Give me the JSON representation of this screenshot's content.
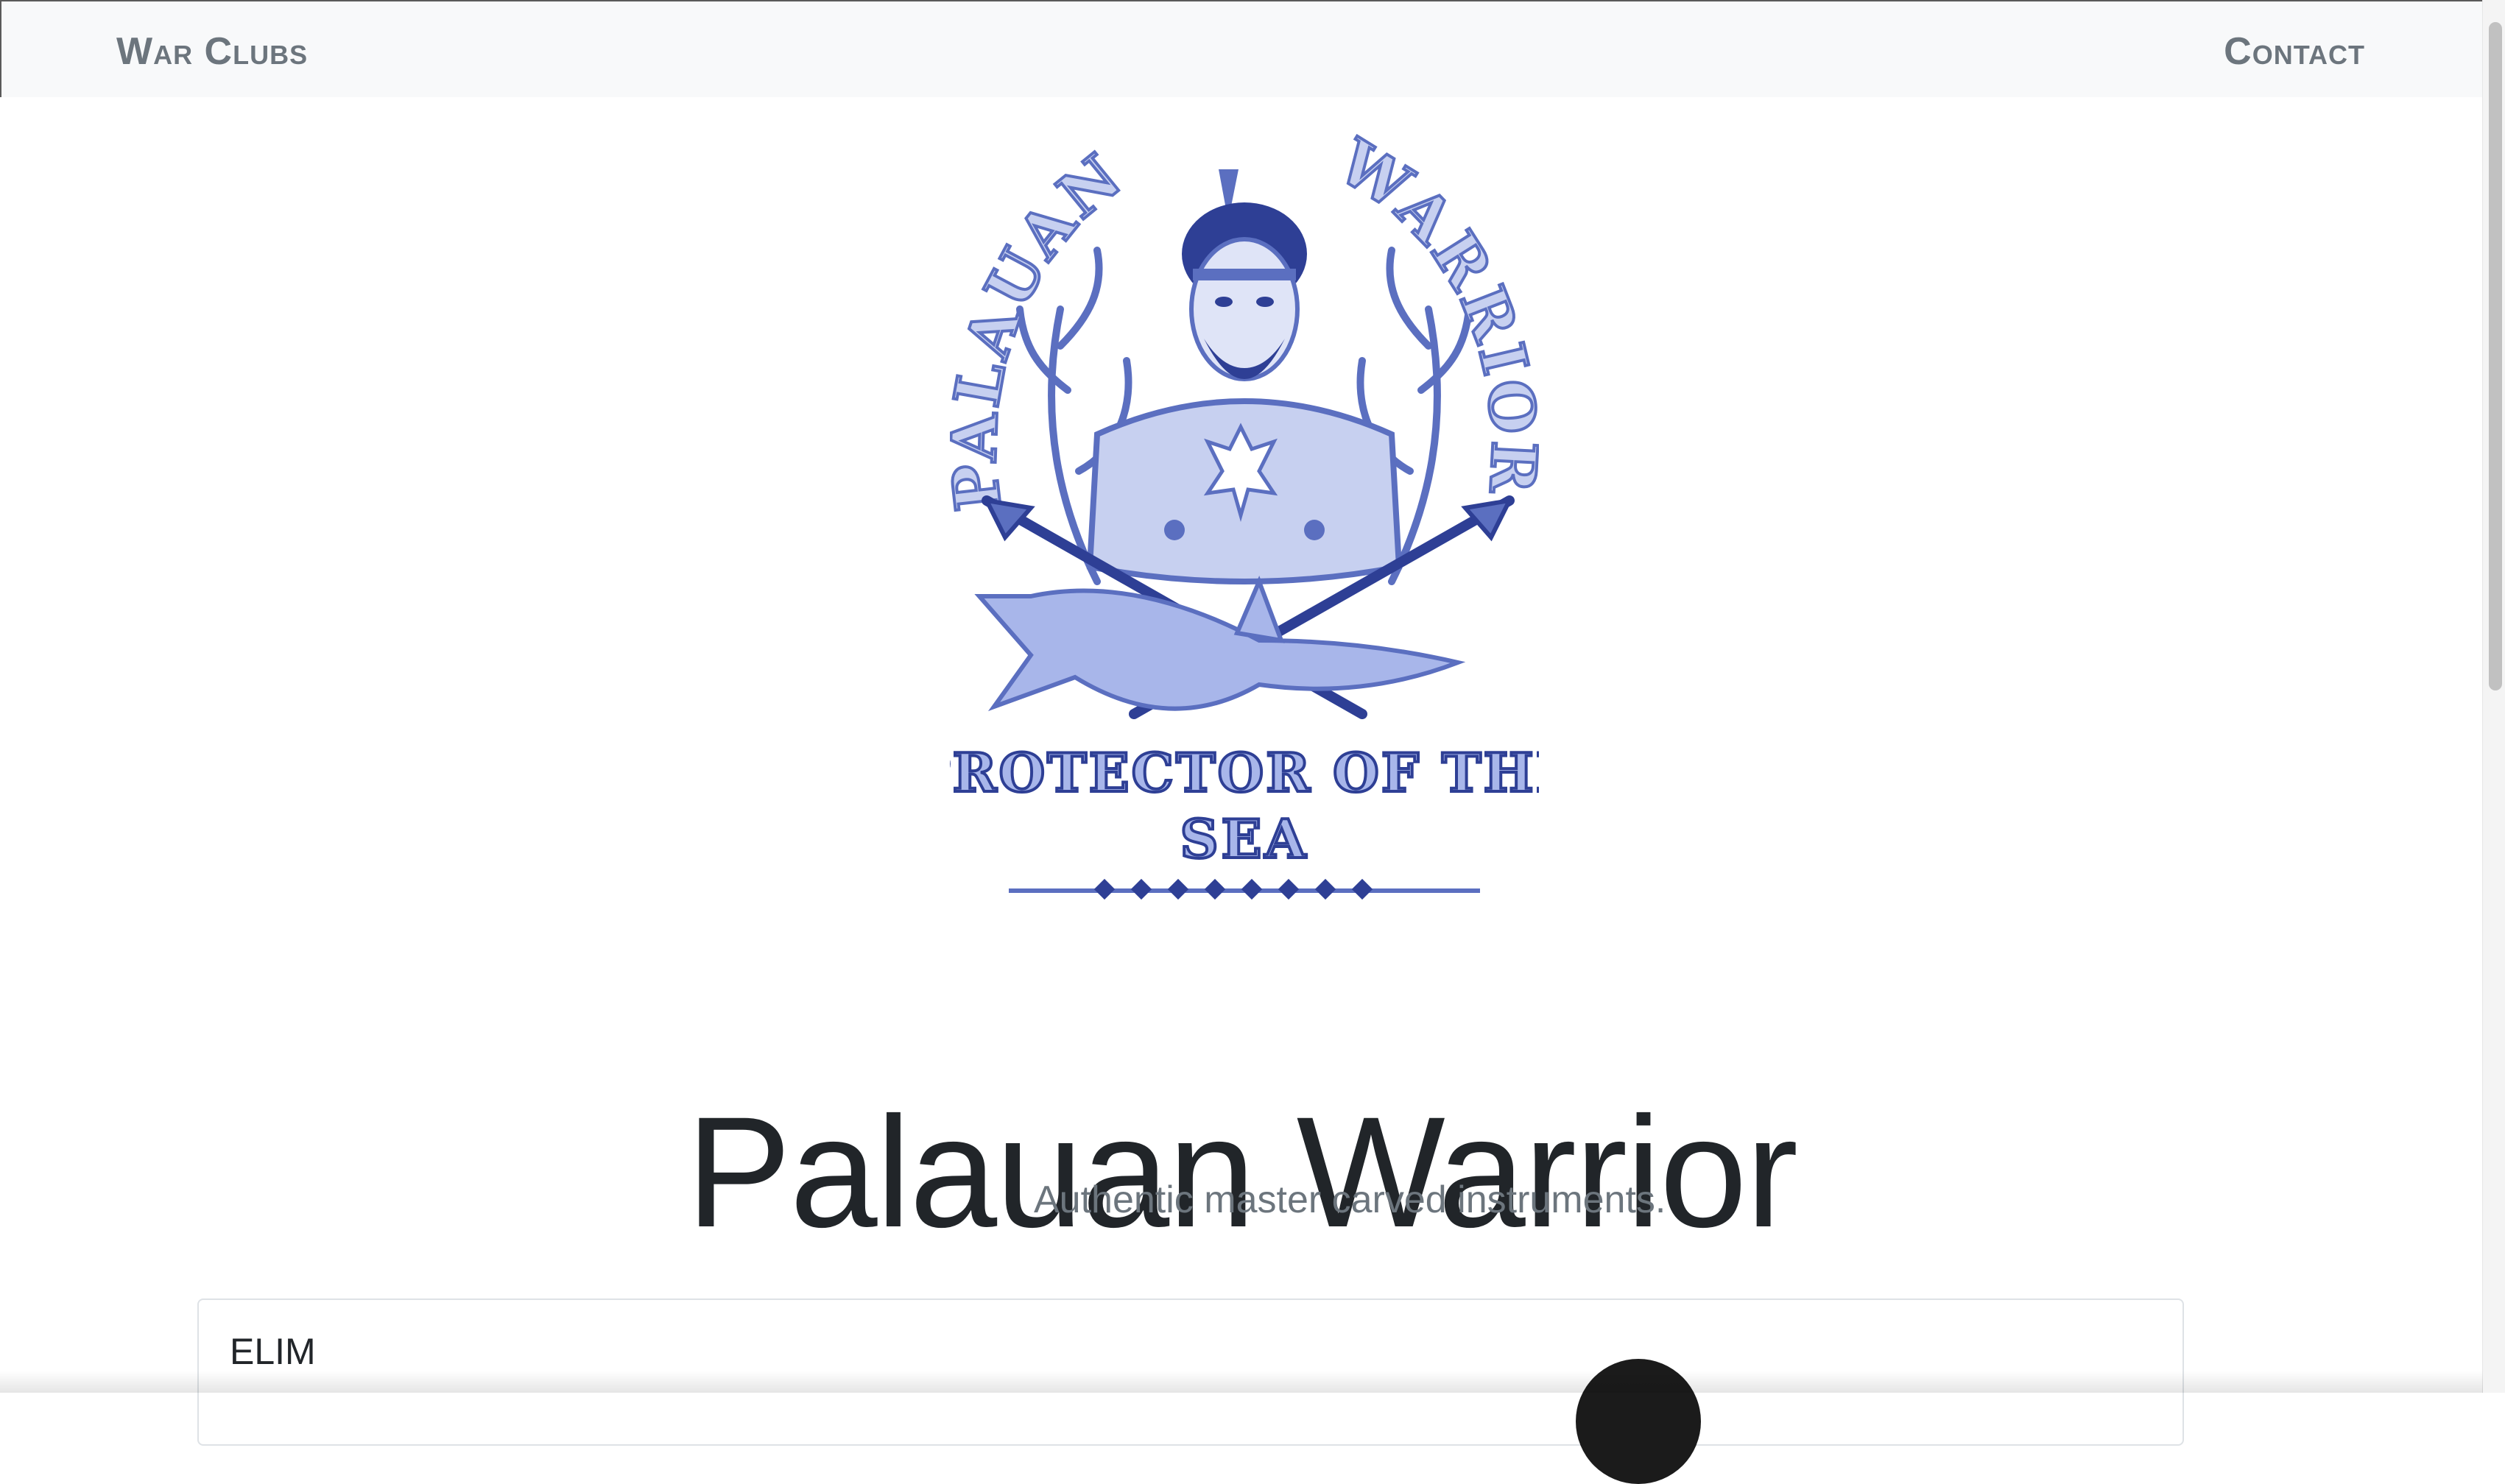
{
  "navbar": {
    "brand": "War Clubs",
    "contact": "Contact"
  },
  "hero": {
    "title": "Palauan Warrior",
    "subtitle": "Authentic master carved instruments.",
    "image_text": {
      "left_arc": "PALAUAN",
      "right_arc": "WARRIOR",
      "banner_line1": "PROTECTOR OF THE",
      "banner_line2": "SEA"
    }
  },
  "card": {
    "title": "ELIM"
  },
  "colors": {
    "navbar_bg": "#f8f9fa",
    "nav_text": "#6c757d",
    "art_blue": "#5b6fc0",
    "art_light": "#c7d0f0",
    "title_text": "#212529"
  }
}
